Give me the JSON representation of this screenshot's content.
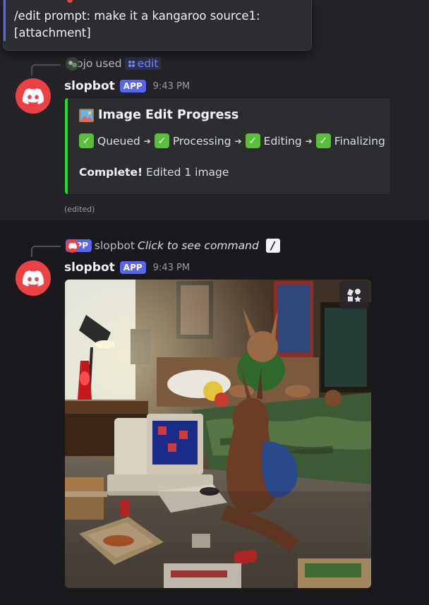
{
  "tooltip": {
    "text": "/edit prompt: make it a kangaroo source1: [attachment]"
  },
  "message1": {
    "reply": {
      "user": "mojo",
      "used": "used",
      "command": "edit"
    },
    "author": "slopbot",
    "badge": "APP",
    "time": "9:43 PM",
    "embed": {
      "title": "Image Edit Progress",
      "steps": [
        "Queued",
        "Processing",
        "Editing",
        "Finalizing"
      ],
      "complete_label": "Complete!",
      "complete_text": "Edited 1 image",
      "accent_color": "#17e31e"
    },
    "edited": "(edited)"
  },
  "message2": {
    "reply": {
      "badge": "APP",
      "user": "slopbot",
      "hint": "Click to see command"
    },
    "author": "slopbot",
    "badge": "APP",
    "time": "9:43 PM"
  },
  "colors": {
    "brand": "#5865f2",
    "avatar": "#ed4245"
  }
}
